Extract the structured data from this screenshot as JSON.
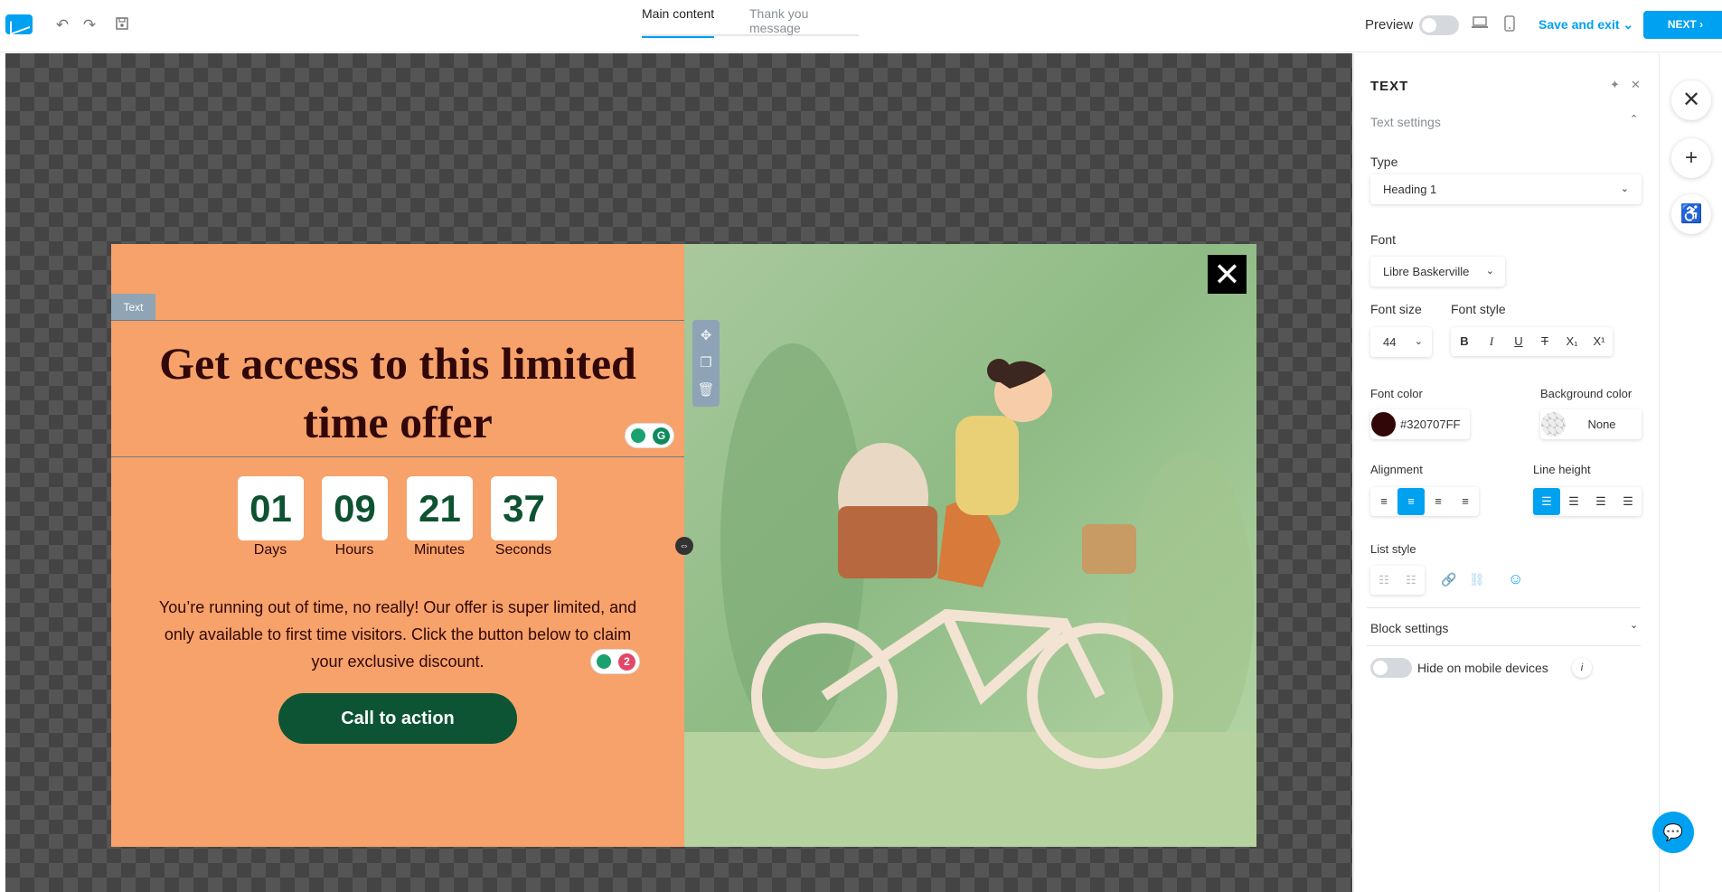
{
  "topbar": {
    "tabs": [
      "Main content",
      "Thank you message"
    ],
    "preview_label": "Preview",
    "save_label": "Save and exit",
    "next_label": "NEXT"
  },
  "popup": {
    "element_label": "Text",
    "headline": "Get access to this limited time offer",
    "countdown": [
      {
        "value": "01",
        "label": "Days"
      },
      {
        "value": "09",
        "label": "Hours"
      },
      {
        "value": "21",
        "label": "Minutes"
      },
      {
        "value": "37",
        "label": "Seconds"
      }
    ],
    "body": "You’re running out of time, no really! Our offer is super limited, and only available to first time visitors. Click the button below to claim your exclusive discount.",
    "cta_label": "Call to action",
    "hint_badge": "2"
  },
  "panel": {
    "title": "TEXT",
    "section_text_settings": "Text settings",
    "type_label": "Type",
    "type_value": "Heading 1",
    "font_label": "Font",
    "font_value": "Libre Baskerville",
    "font_size_label": "Font size",
    "font_size_value": "44",
    "font_style_label": "Font style",
    "font_color_label": "Font color",
    "font_color_value": "#320707FF",
    "font_color_swatch": "#320707",
    "background_color_label": "Background color",
    "background_color_value": "None",
    "alignment_label": "Alignment",
    "line_height_label": "Line height",
    "list_style_label": "List style",
    "block_settings_label": "Block settings",
    "hide_mobile_label": "Hide on mobile devices"
  },
  "colors": {
    "accent": "#00a1f1",
    "popup_bg": "#f6a26a",
    "cta": "#0c5434",
    "heading": "#320707"
  }
}
